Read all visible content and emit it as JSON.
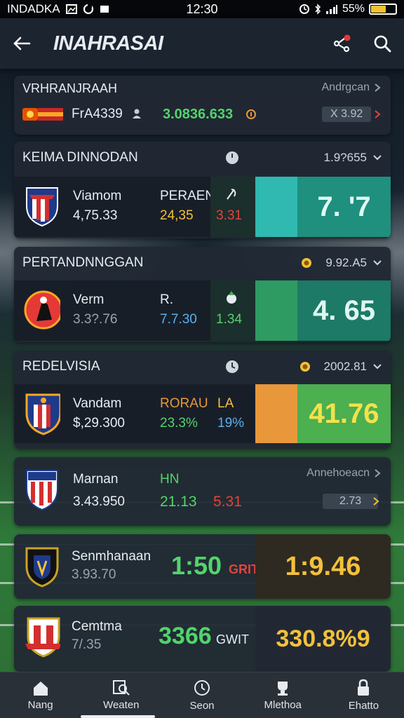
{
  "status_bar": {
    "carrier": "INDADKA",
    "time": "12:30",
    "battery": "55%",
    "battery_level": 0.57
  },
  "header": {
    "title": "INAHRASAI"
  },
  "summary_card": {
    "title": "VRHRANJRAAH",
    "link": "Andrgcan",
    "row": {
      "team": "FrA4339",
      "value": "3.0836.633",
      "odds": "X 3.92"
    }
  },
  "section1": {
    "title": "KEIMA DINNODAN",
    "right_value": "1.9?655",
    "row": {
      "team": "Viamom",
      "team_value": "4,75.33",
      "label": "PERAEN",
      "label_value": "24,35",
      "mid_value": "3.31",
      "big_value": "7. '7"
    }
  },
  "section2": {
    "title": "PERTANDNNGGAN",
    "right_value": "9.92.A5",
    "row": {
      "team": "Verm",
      "team_value": "3.3?.76",
      "label": "R.",
      "label_value": "7.7.30",
      "mid_value": "1.34",
      "big_value": "4. 65"
    }
  },
  "section3": {
    "title": "REDELVISIA",
    "right_value": "2002.81",
    "row": {
      "team": "Vandam",
      "team_value": "$,29.300",
      "label": "RORAU",
      "label_value": "23.3%",
      "mid_label": "LA",
      "mid_value": "19%",
      "big_value": "41.76"
    }
  },
  "card4": {
    "link": "Annehoeacn",
    "team": "Marnan",
    "team_value": "3.43.950",
    "label": "HN",
    "label_value": "21.13",
    "mid_value": "5.31",
    "odds": "2.73"
  },
  "card5": {
    "team": "Senmhanaan",
    "team_value": "3.93.70",
    "score": "1:50",
    "unit": "GRIT",
    "big_value": "1:9.46"
  },
  "card6": {
    "team": "Cemtma",
    "team_value": "7/.35",
    "score": "3366",
    "unit": "GWIT",
    "big_value": "330.8%9"
  },
  "bottom_nav": [
    {
      "label": "Nang",
      "icon": "home-icon"
    },
    {
      "label": "Weaten",
      "icon": "search-doc-icon"
    },
    {
      "label": "Seon",
      "icon": "clock-icon"
    },
    {
      "label": "Mlethoa",
      "icon": "trophy-icon"
    },
    {
      "label": "Ehatto",
      "icon": "lock-icon"
    }
  ],
  "colors": {
    "teal": "#1f8f7e",
    "cyan": "#2fb9b0",
    "green": "#4caf50",
    "orange": "#e8973a",
    "yellow_text": "#f3c13a",
    "green_text": "#52d46b",
    "red_text": "#e5433b",
    "blue_text": "#5ab0f0"
  }
}
